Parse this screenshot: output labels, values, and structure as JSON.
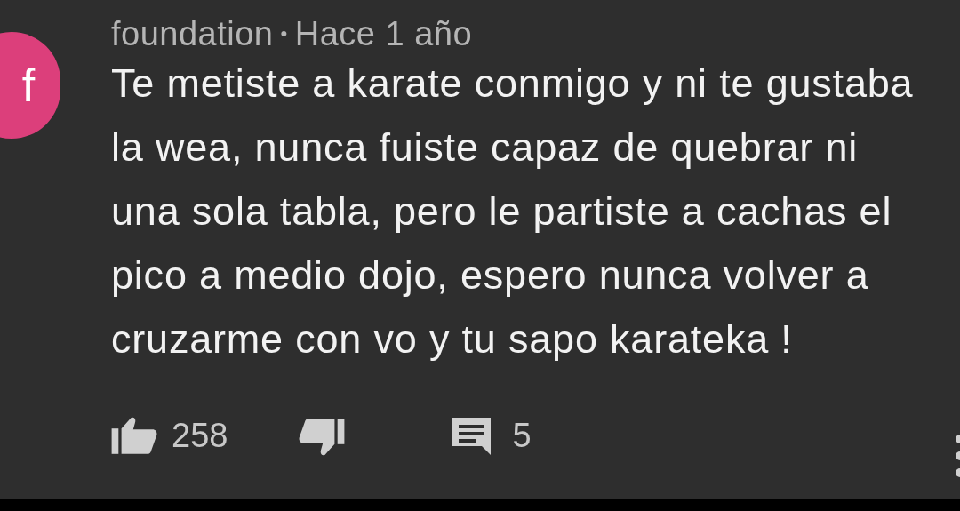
{
  "comment": {
    "avatar_letter": "f",
    "author": "foundation",
    "separator": "•",
    "time": "Hace 1 año",
    "text_lines": [
      "Te metiste a karate conmigo y ni te gustaba",
      "la wea, nunca fuiste capaz de quebrar ni",
      "una sola tabla, pero le partiste a cachas el",
      "pico a medio dojo, espero nunca volver a",
      "cruzarme con vo y tu sapo karateka !"
    ],
    "likes": "258",
    "replies": "5"
  }
}
